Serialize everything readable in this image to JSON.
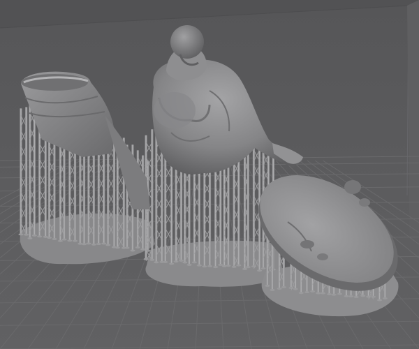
{
  "viewport": {
    "view": "3d-perspective",
    "background_color": "#5a5a5c",
    "grid_color": "#6a6a6c",
    "model_color": "#8a8a8c",
    "support_color": "#a3a3a5"
  },
  "scene": {
    "objects": [
      {
        "id": "model-legs-with-supports",
        "kind": "3d-model"
      },
      {
        "id": "model-torso-bust-with-supports",
        "kind": "3d-model"
      },
      {
        "id": "model-round-base-with-supports",
        "kind": "3d-model"
      }
    ]
  }
}
